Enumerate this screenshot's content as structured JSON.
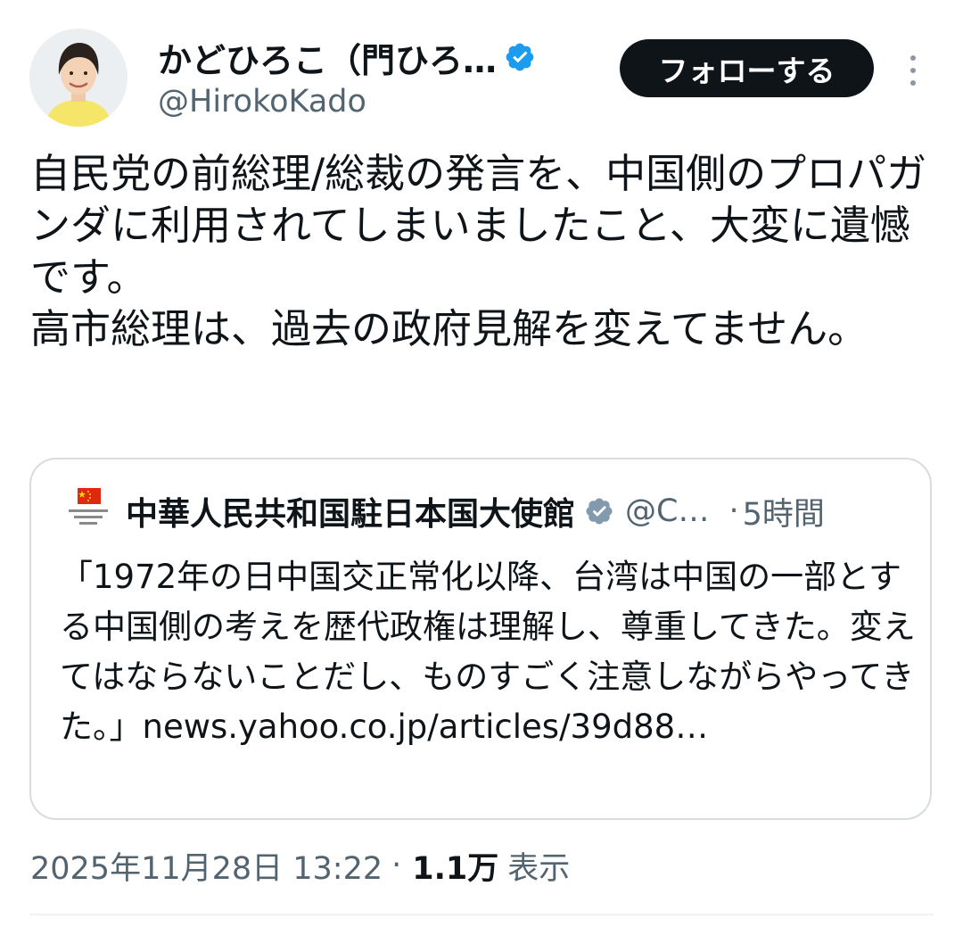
{
  "author": {
    "display_name": "かどひろこ（門ひろ…",
    "handle": "@HirokoKado",
    "avatar_icon": "profile-photo",
    "verified_icon": "verified-badge-icon",
    "verified_color": "#1d9bf0"
  },
  "actions": {
    "follow_label": "フォローする",
    "more_icon": "more-vertical-icon"
  },
  "tweet": {
    "text": "自民党の前総理/総裁の発言を、中国側のプロパガンダに利用されてしまいましたこと、大変に遺憾です。\n高市総理は、過去の政府見解を変えてません。"
  },
  "quote": {
    "name": "中華人民共和国駐日本国大使館",
    "handle": "@C…",
    "separator": "·",
    "time": "5時間",
    "verified_icon": "verified-badge-gray-icon",
    "verified_color": "#829aab",
    "avatar_icon": "embassy-flag-logo",
    "avatar_lettering": [
      "中華人民共和国",
      "駐日本国",
      "大使館"
    ],
    "text": "「1972年の日中国交正常化以降、台湾は中国の一部とする中国側の考えを歴代政権は理解し、尊重してきた。変えてはならないことだし、ものすごく注意しながらやってきた。」news.yahoo.co.jp/articles/39d88…"
  },
  "meta": {
    "timestamp": "2025年11月28日 13:22",
    "separator": "·",
    "views_count": "1.1万",
    "views_label": "表示"
  },
  "colors": {
    "text_primary": "#0f1419",
    "text_secondary": "#536471",
    "follow_button_bg": "#0f1419",
    "border": "#d7dce0"
  }
}
